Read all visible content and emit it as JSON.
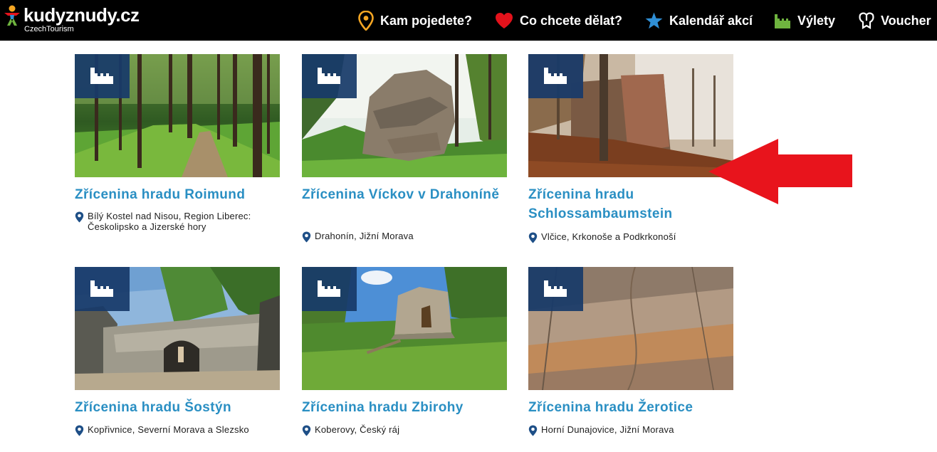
{
  "header": {
    "logo_text": "kudyznudy.cz",
    "logo_subtext": "CzechTourism",
    "nav": [
      {
        "label": "Kam pojedete?",
        "icon": "location-pin-icon",
        "color": "#f5a623"
      },
      {
        "label": "Co chcete dělat?",
        "icon": "heart-icon",
        "color": "#e3121b"
      },
      {
        "label": "Kalendář akcí",
        "icon": "star-icon",
        "color": "#2f8fd6"
      },
      {
        "label": "Výlety",
        "icon": "castle-icon",
        "color": "#6fb43f"
      },
      {
        "label": "Voucher",
        "icon": "voucher-icon",
        "color": "#ffffff"
      }
    ]
  },
  "cards": [
    {
      "title": "Zřícenina hradu Roimund",
      "location": "Bílý Kostel nad Nisou, Region Liberec: Českolipsko a Jizerské hory",
      "badge_icon": "castle-icon",
      "image": "forest-path"
    },
    {
      "title": "Zřícenina Víckov v Drahoníně",
      "location": "Drahonín, Jižní Morava",
      "badge_icon": "castle-icon",
      "image": "ruin-rock-forest"
    },
    {
      "title": "Zřícenina hradu Schlossambaumstein",
      "location": "Vlčice, Krkonoše a Podkrkonoší",
      "badge_icon": "castle-icon",
      "image": "autumn-ruin"
    },
    {
      "title": "Zřícenina hradu Šostýn",
      "location": "Kopřivnice, Severní Morava a Slezsko",
      "badge_icon": "castle-icon",
      "image": "stone-wall-arch"
    },
    {
      "title": "Zřícenina hradu Zbirohy",
      "location": "Koberovy, Český ráj",
      "badge_icon": "castle-icon",
      "image": "ruin-meadow"
    },
    {
      "title": "Zřícenina hradu Žerotice",
      "location": "Horní Dunajovice, Jižní Morava",
      "badge_icon": "castle-icon",
      "image": "sandstone-rock"
    }
  ],
  "annotation": {
    "type": "red-arrow",
    "color": "#e8141c",
    "points_to": "Zřícenina hradu Schlossambaumstein"
  }
}
